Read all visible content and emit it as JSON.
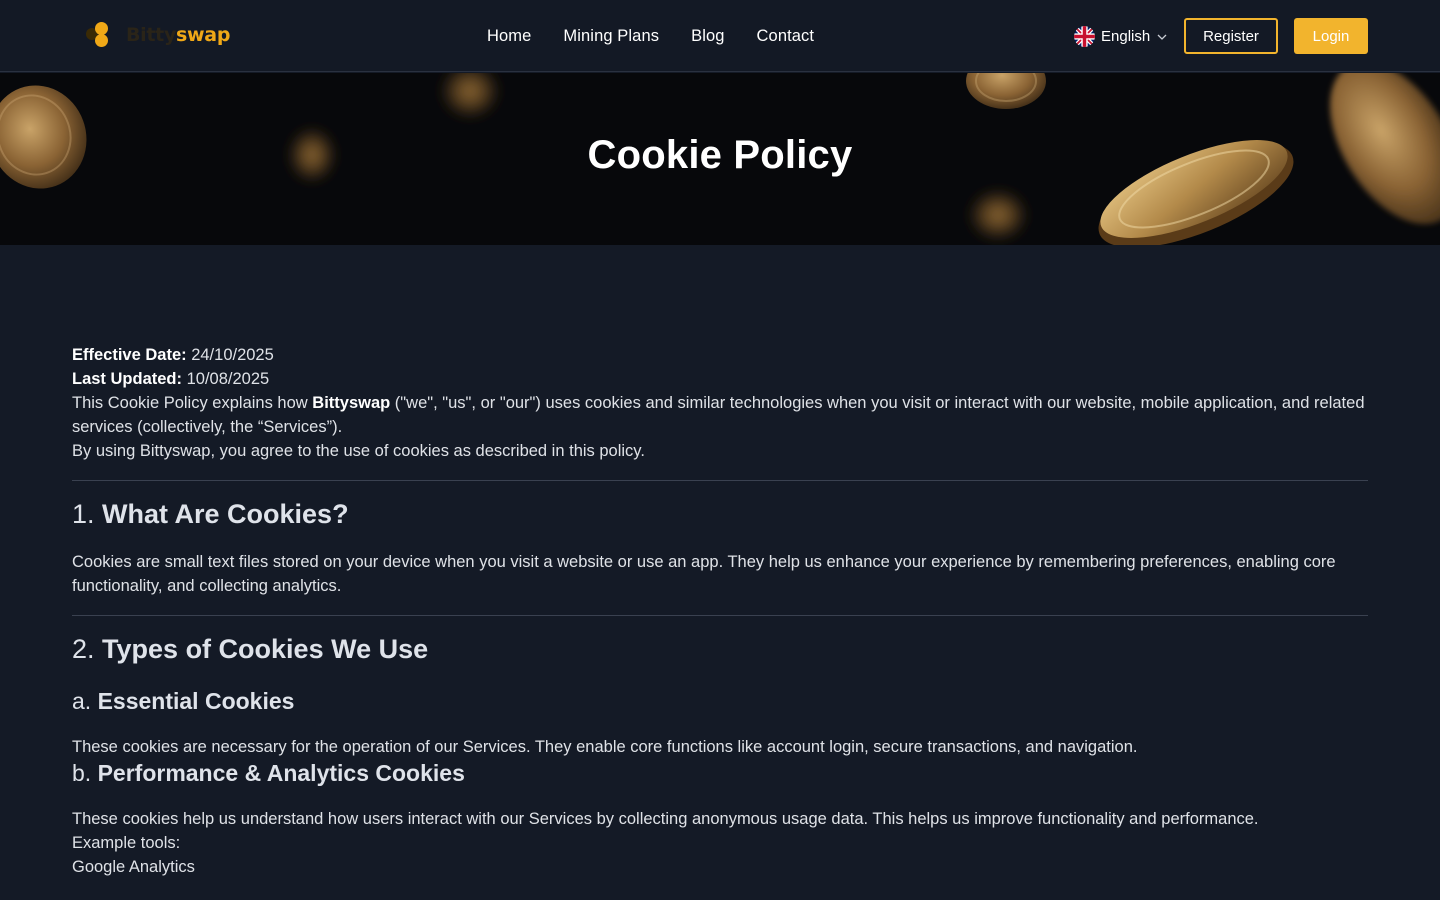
{
  "header": {
    "logo": {
      "dark": "Bitty",
      "gold": "swap"
    },
    "nav": [
      {
        "label": "Home"
      },
      {
        "label": "Mining Plans"
      },
      {
        "label": "Blog"
      },
      {
        "label": "Contact"
      }
    ],
    "language": "English",
    "register_label": "Register",
    "login_label": "Login"
  },
  "hero": {
    "title": "Cookie Policy"
  },
  "policy": {
    "effective_label": "Effective Date:",
    "effective_value": " 24/10/2025",
    "updated_label": "Last Updated:",
    "updated_value": " 10/08/2025",
    "intro_pre": "This Cookie Policy explains how ",
    "intro_brand": "Bittyswap",
    "intro_post": " (\"we\", \"us\", or \"our\") uses cookies and similar technologies when you visit or interact with our website, mobile application, and related services (collectively, the “Services”).",
    "consent": "By using Bittyswap, you agree to the use of cookies as described in this policy.",
    "s1_num": "1.",
    "s1_title": " What Are Cookies?",
    "s1_body": "Cookies are small text files stored on your device when you visit a website or use an app. They help us enhance your experience by remembering preferences, enabling core functionality, and collecting analytics.",
    "s2_num": "2.",
    "s2_title": " Types of Cookies We Use",
    "s2a_num": "a.",
    "s2a_title": " Essential Cookies",
    "s2a_body": "These cookies are necessary for the operation of our Services. They enable core functions like account login, secure transactions, and navigation.",
    "s2b_num": "b.",
    "s2b_title": " Performance & Analytics Cookies",
    "s2b_body": "These cookies help us understand how users interact with our Services by collecting anonymous usage data. This helps us improve functionality and performance.",
    "tools_label": "Example tools:",
    "tool_1": "Google Analytics"
  },
  "colors": {
    "accent": "#f2b42d",
    "page_bg": "#141a26",
    "header_bg": "#131925"
  }
}
